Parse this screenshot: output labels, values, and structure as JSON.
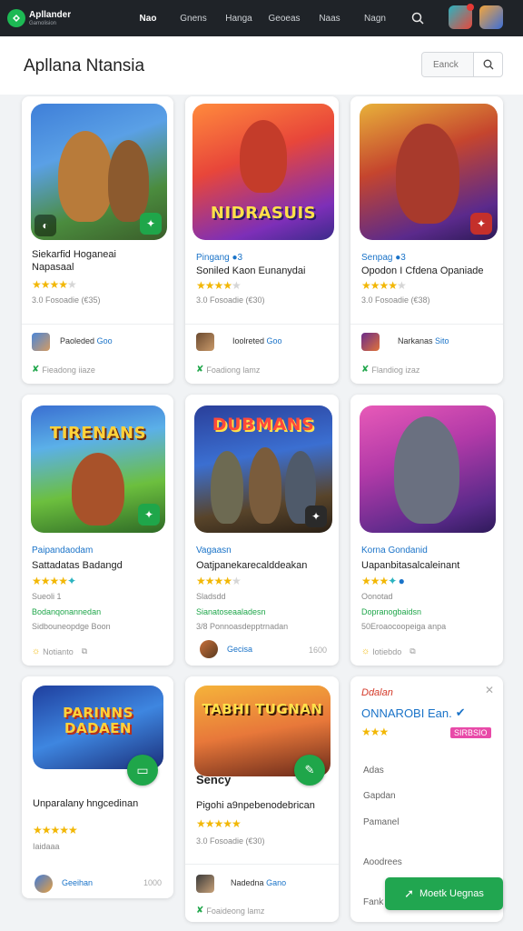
{
  "nav": {
    "brand_name": "Apllander",
    "brand_sub": "Gamolision",
    "items": [
      "Nao",
      "Gnens",
      "Hanga",
      "Geoeas",
      "Naas",
      "Nagn"
    ]
  },
  "header": {
    "title": "Apllana Ntansia",
    "search_placeholder": "Eanck"
  },
  "cards": [
    {
      "thumb_title": "",
      "genre": "",
      "name": "Siekarfid Hoganeai\nNapasaal",
      "rating": "3.0 Fosoadie (€35)",
      "dev": "Paoleded",
      "dev_tag": "Goo",
      "foot": "Fieadong iiaze"
    },
    {
      "thumb_title": "NIDRASUIS",
      "genre": "Pingang ●3",
      "name": "Soniled Kaon Eunanydai",
      "rating": "3.0 Fosoadie (€30)",
      "dev": "Ioolreted",
      "dev_tag": "Goo",
      "foot": "Foadiong lamz"
    },
    {
      "thumb_title": "",
      "genre": "Senpag ●3",
      "name": "Opodon I Cfdena Opaniade",
      "rating": "3.0 Fosoadie (€38)",
      "dev": "Narkanas",
      "dev_tag": "Sito",
      "foot": "Flandiog izaz"
    },
    {
      "thumb_title": "TIRENANS",
      "genre": "Paipandaodam",
      "name": "Sattadatas Badangd",
      "sub": "Sueoli 1",
      "green": "Bodanqonannedan",
      "rating": "Sidbouneopdge Boon",
      "foot": "Notianto",
      "foot_right": ""
    },
    {
      "thumb_title": "DUBMANS",
      "genre": "Vagaasn",
      "name": "Oatjpanekarecalddeakan",
      "sub": "Sladsdd",
      "green": "Sianatoseaaladesn",
      "rating": "3/8 Ponnoasdepptrnadan",
      "dev": "Gecisa",
      "dev_right": "1600"
    },
    {
      "thumb_title": "",
      "genre": "Korna Gondanid",
      "name": "Uapanbitasalcaleinant",
      "sub": "Oonotad",
      "green": "Dopranogbaidsn",
      "rating": "50Eroaocoopeiga anpa",
      "foot": "Iotiebdo"
    },
    {
      "thumb_title": "PARINNS DADAEN",
      "genre": "",
      "name": "Unparalany hngcedinan",
      "rating": "Iaidaaa",
      "dev": "Geeihan",
      "dev_right": "1000"
    },
    {
      "thumb_title": "TABHI TUGNAN",
      "thumb_sub": "Sency",
      "name": "Pigohi a9npebenodebrican",
      "rating": "3.0 Fosoadie (€30)",
      "dev": "Nadedna",
      "dev_tag": "Gano",
      "foot": "Foaideong lamz"
    }
  ],
  "panel": {
    "label": "Ddalan",
    "title": "ONNAROBI Ean.",
    "rating_tag": "SIRBSIO",
    "rows": [
      "Adas",
      "Gapdan",
      "Pamanel",
      "Aoodrees",
      "Fank"
    ],
    "cta": "Moetk Uegnas"
  },
  "colors": {
    "accent_green": "#21a650",
    "accent_blue": "#1a73c8",
    "star": "#f2b705",
    "topbar": "#1f2328"
  }
}
